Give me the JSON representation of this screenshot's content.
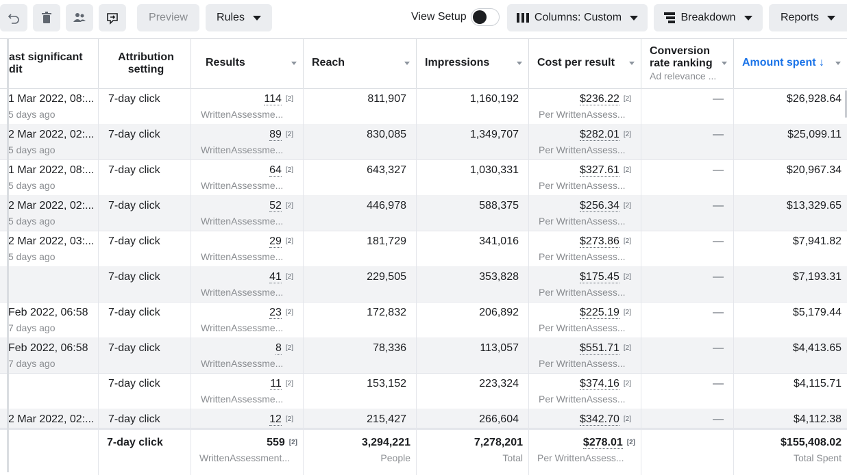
{
  "toolbar": {
    "preview_label": "Preview",
    "rules_label": "Rules",
    "view_setup_label": "View Setup",
    "columns_label": "Columns: Custom",
    "breakdown_label": "Breakdown",
    "reports_label": "Reports"
  },
  "headers": {
    "edit_line1": "ast significant",
    "edit_line2": "dit",
    "attribution_line1": "Attribution",
    "attribution_line2": "setting",
    "results": "Results",
    "reach": "Reach",
    "impressions": "Impressions",
    "cost_per_result": "Cost per result",
    "conversion_line1": "Conversion",
    "conversion_line2": "rate ranking",
    "conversion_sub": "Ad relevance ...",
    "amount_spent": "Amount spent ↓"
  },
  "colors": {
    "accent": "#1a73e8"
  },
  "rows": [
    {
      "edit": "1 Mar 2022, 08:...",
      "edit_sub": "5 days ago",
      "attribution": "7-day click",
      "results": "114",
      "results_sub": "WrittenAssessme...",
      "reach": "811,907",
      "impressions": "1,160,192",
      "cpr": "$236.22",
      "cpr_sub": "Per WrittenAssess...",
      "ranking": "—",
      "spent": "$26,928.64"
    },
    {
      "edit": "2 Mar 2022, 02:...",
      "edit_sub": "5 days ago",
      "attribution": "7-day click",
      "results": "89",
      "results_sub": "WrittenAssessme...",
      "reach": "830,085",
      "impressions": "1,349,707",
      "cpr": "$282.01",
      "cpr_sub": "Per WrittenAssess...",
      "ranking": "—",
      "spent": "$25,099.11"
    },
    {
      "edit": "1 Mar 2022, 08:...",
      "edit_sub": "5 days ago",
      "attribution": "7-day click",
      "results": "64",
      "results_sub": "WrittenAssessme...",
      "reach": "643,327",
      "impressions": "1,030,331",
      "cpr": "$327.61",
      "cpr_sub": "Per WrittenAssess...",
      "ranking": "—",
      "spent": "$20,967.34"
    },
    {
      "edit": "2 Mar 2022, 02:...",
      "edit_sub": "5 days ago",
      "attribution": "7-day click",
      "results": "52",
      "results_sub": "WrittenAssessme...",
      "reach": "446,978",
      "impressions": "588,375",
      "cpr": "$256.34",
      "cpr_sub": "Per WrittenAssess...",
      "ranking": "—",
      "spent": "$13,329.65"
    },
    {
      "edit": "2 Mar 2022, 03:...",
      "edit_sub": "5 days ago",
      "attribution": "7-day click",
      "results": "29",
      "results_sub": "WrittenAssessme...",
      "reach": "181,729",
      "impressions": "341,016",
      "cpr": "$273.86",
      "cpr_sub": "Per WrittenAssess...",
      "ranking": "—",
      "spent": "$7,941.82"
    },
    {
      "edit": "",
      "edit_sub": "",
      "attribution": "7-day click",
      "results": "41",
      "results_sub": "WrittenAssessme...",
      "reach": "229,505",
      "impressions": "353,828",
      "cpr": "$175.45",
      "cpr_sub": "Per WrittenAssess...",
      "ranking": "—",
      "spent": "$7,193.31"
    },
    {
      "edit": "Feb 2022, 06:58",
      "edit_sub": "7 days ago",
      "attribution": "7-day click",
      "results": "23",
      "results_sub": "WrittenAssessme...",
      "reach": "172,832",
      "impressions": "206,892",
      "cpr": "$225.19",
      "cpr_sub": "Per WrittenAssess...",
      "ranking": "—",
      "spent": "$5,179.44"
    },
    {
      "edit": "Feb 2022, 06:58",
      "edit_sub": "7 days ago",
      "attribution": "7-day click",
      "results": "8",
      "results_sub": "WrittenAssessme...",
      "reach": "78,336",
      "impressions": "113,057",
      "cpr": "$551.71",
      "cpr_sub": "Per WrittenAssess...",
      "ranking": "—",
      "spent": "$4,413.65"
    },
    {
      "edit": "",
      "edit_sub": "",
      "attribution": "7-day click",
      "results": "11",
      "results_sub": "WrittenAssessme...",
      "reach": "153,152",
      "impressions": "223,324",
      "cpr": "$374.16",
      "cpr_sub": "Per WrittenAssess...",
      "ranking": "—",
      "spent": "$4,115.71"
    },
    {
      "edit": "2 Mar 2022, 02:...",
      "edit_sub": "",
      "attribution": "7-day click",
      "results": "12",
      "results_sub": "",
      "reach": "215,427",
      "impressions": "266,604",
      "cpr": "$342.70",
      "cpr_sub": "",
      "ranking": "—",
      "spent": "$4,112.38"
    }
  ],
  "results_badge": "[2]",
  "totals": {
    "attribution": "7-day click",
    "results": "559",
    "results_sub": "WrittenAssessment...",
    "reach": "3,294,221",
    "reach_sub": "People",
    "impressions": "7,278,201",
    "impressions_sub": "Total",
    "cpr": "$278.01",
    "cpr_sub": "Per WrittenAssess...",
    "spent": "$155,408.02",
    "spent_sub": "Total Spent"
  }
}
